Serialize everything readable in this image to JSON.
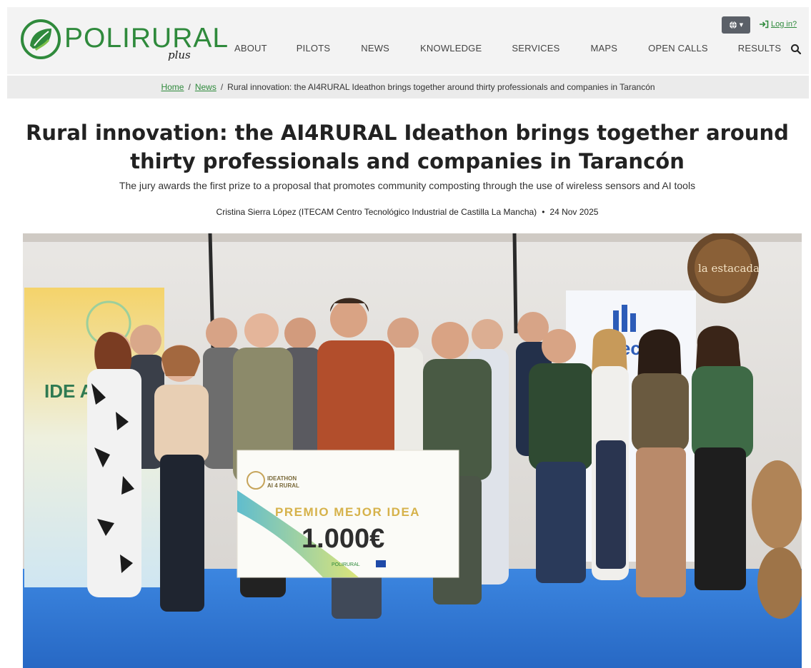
{
  "site": {
    "logo_text": "POLIRURAL",
    "logo_suffix": "plus"
  },
  "header": {
    "login_label": "Log in?",
    "nav": [
      {
        "label": "ABOUT"
      },
      {
        "label": "PILOTS"
      },
      {
        "label": "NEWS"
      },
      {
        "label": "KNOWLEDGE"
      },
      {
        "label": "SERVICES"
      },
      {
        "label": "MAPS"
      },
      {
        "label": "OPEN CALLS"
      },
      {
        "label": "RESULTS"
      }
    ]
  },
  "breadcrumb": {
    "home": "Home",
    "news": "News",
    "current": "Rural innovation: the AI4RURAL Ideathon brings together around thirty professionals and companies in Tarancón"
  },
  "article": {
    "title": "Rural innovation: the AI4RURAL Ideathon brings together around thirty professionals and companies in Tarancón",
    "subtitle": "The jury awards the first prize to a proposal that promotes community composting through the use of wireless sensors and AI tools",
    "author": "Cristina Sierra López (ITECAM Centro Tecnológico Industrial de Castilla La Mancha)",
    "date": "24 Nov 2025"
  },
  "photo": {
    "banner_left": "IDE AI",
    "barrel_sign": "la estacada",
    "banner_right": "itecam",
    "check_logo_line1": "IDEATHON",
    "check_logo_line2": "AI 4 RURAL",
    "check_heading": "PREMIO MEJOR IDEA",
    "check_amount": "1.000€",
    "check_footer": "POLIRURAL"
  },
  "colors": {
    "brand_green": "#2f8a3c",
    "header_bg": "#f3f3f3",
    "breadcrumb_bg": "#ebebeb",
    "stage_blue": "#2f7bd9"
  }
}
